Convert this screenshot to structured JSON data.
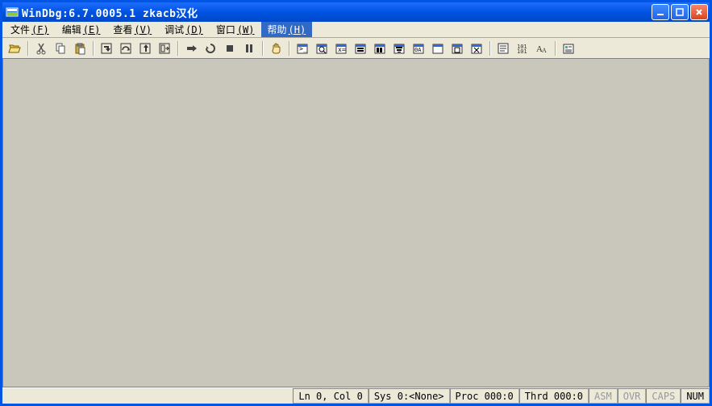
{
  "window": {
    "title": "WinDbg:6.7.0005.1 zkacb汉化"
  },
  "menu": {
    "items": [
      {
        "label": "文件",
        "mnemonic": "(F)"
      },
      {
        "label": "编辑",
        "mnemonic": "(E)"
      },
      {
        "label": "查看",
        "mnemonic": "(V)"
      },
      {
        "label": "调试",
        "mnemonic": "(D)"
      },
      {
        "label": "窗口",
        "mnemonic": "(W)"
      },
      {
        "label": "帮助",
        "mnemonic": "(H)",
        "active": true
      }
    ]
  },
  "toolbar": {
    "icons": [
      "open-icon",
      "|",
      "cut-icon",
      "copy-icon",
      "paste-icon",
      "|",
      "step-into-icon",
      "step-over-icon",
      "step-out-icon",
      "run-to-cursor-icon",
      "|",
      "go-icon",
      "restart-icon",
      "stop-icon",
      "break-icon",
      "|",
      "hand-icon",
      "|",
      "command-window-icon",
      "watch-window-icon",
      "locals-window-icon",
      "registers-window-icon",
      "memory-window-icon",
      "callstack-window-icon",
      "disassembly-window-icon",
      "scratch-icon",
      "processes-icon",
      "threads-icon",
      "|",
      "source-mode-icon",
      "binary-mode-icon",
      "font-icon",
      "|",
      "options-icon"
    ]
  },
  "statusbar": {
    "lncol": "Ln 0, Col 0",
    "sys": "Sys 0:<None>",
    "proc": "Proc 000:0",
    "thrd": "Thrd 000:0",
    "asm": "ASM",
    "ovr": "OVR",
    "caps": "CAPS",
    "num": "NUM"
  }
}
